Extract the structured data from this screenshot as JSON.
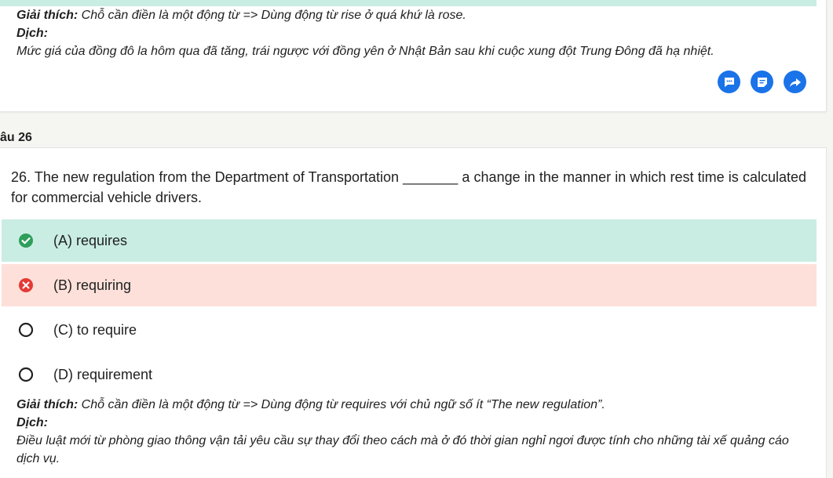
{
  "prev_card": {
    "explanation_label": "Giải thích:",
    "explanation_text": " Chỗ cần điền là một động từ => Dùng động từ rise ở quá khứ là rose.",
    "translation_label": "Dịch:",
    "translation_text": "Mức giá của đồng đô la hôm qua đã tăng, trái ngược với đồng yên ở Nhật Bản sau khi cuộc xung đột Trung Đông đã hạ nhiệt.",
    "actions": [
      {
        "name": "comment",
        "icon": "chat-bubble-icon"
      },
      {
        "name": "note",
        "icon": "note-icon"
      },
      {
        "name": "share",
        "icon": "share-arrow-icon"
      }
    ],
    "accent_color": "#1a73e8"
  },
  "question": {
    "label": "âu 26",
    "text": "26. The new regulation from the Department of Transportation _______ a change in the manner in which rest time is calculated for commercial vehicle drivers.",
    "options": [
      {
        "label": "(A) requires",
        "state": "correct",
        "icon": "check-circle-icon"
      },
      {
        "label": "(B) requiring",
        "state": "wrong",
        "icon": "x-circle-icon"
      },
      {
        "label": "(C) to require",
        "state": "unselected",
        "icon": "radio-empty-icon"
      },
      {
        "label": "(D) requirement",
        "state": "unselected",
        "icon": "radio-empty-icon"
      }
    ],
    "explanation_label": "Giải thích:",
    "explanation_text": " Chỗ cần điền là một động từ => Dùng động từ requires với chủ ngữ số ít “The new regulation”.",
    "translation_label": "Dịch:",
    "translation_text": "Điều luật mới từ phòng giao thông vận tải yêu cầu sự thay đổi theo cách mà ở đó thời gian nghỉ ngơi được tính cho những tài xế quảng cáo dịch vụ."
  },
  "colors": {
    "correct_bg": "#c9ede3",
    "wrong_bg": "#fde0da",
    "correct_icon": "#2e9e5b",
    "wrong_icon": "#e53935"
  }
}
